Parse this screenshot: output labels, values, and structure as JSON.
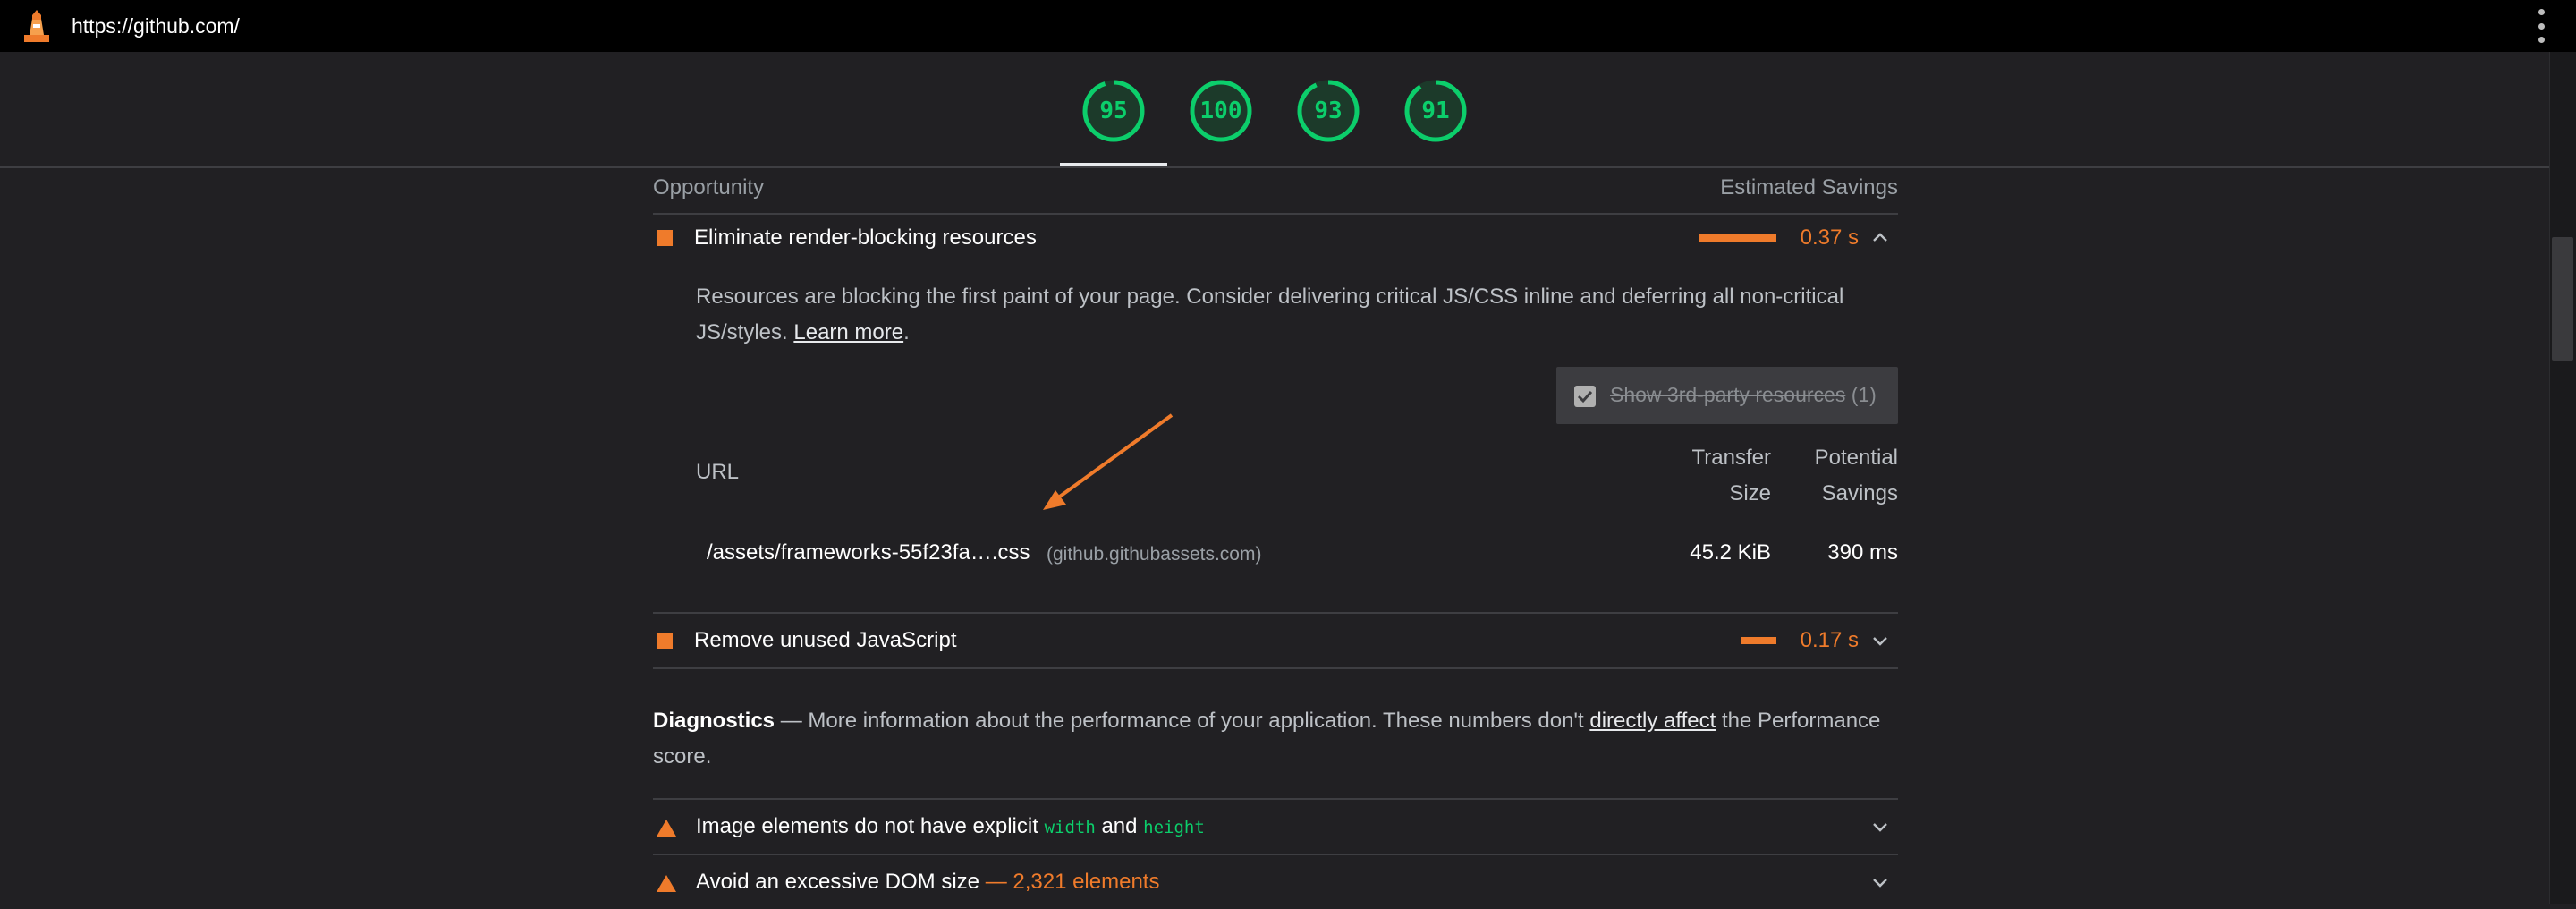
{
  "address_bar": {
    "url": "https://github.com/"
  },
  "scores": [
    {
      "value": "95",
      "fraction": 0.95
    },
    {
      "value": "100",
      "fraction": 1.0
    },
    {
      "value": "93",
      "fraction": 0.93
    },
    {
      "value": "91",
      "fraction": 0.91
    }
  ],
  "colors": {
    "pass": "#0cce6b",
    "warn": "#ef7b2b",
    "background": "#212023"
  },
  "opportunities": {
    "col_left": "Opportunity",
    "col_right": "Estimated Savings",
    "items": [
      {
        "title": "Eliminate render-blocking resources",
        "savings": "0.37 s",
        "expanded": true,
        "description": "Resources are blocking the first paint of your page. Consider delivering critical JS/CSS inline and deferring all non-critical JS/styles.",
        "learn_more": "Learn more",
        "third_party_toggle": {
          "label": "Show 3rd-party resources",
          "count": "(1)",
          "checked": true
        },
        "table": {
          "col_url": "URL",
          "col_transfer_1": "Transfer",
          "col_transfer_2": "Size",
          "col_savings_1": "Potential",
          "col_savings_2": "Savings",
          "rows": [
            {
              "url": "/assets/frameworks-55f23fa….css",
              "host": "(github.githubassets.com)",
              "size": "45.2 KiB",
              "savings": "390 ms"
            }
          ]
        }
      },
      {
        "title": "Remove unused JavaScript",
        "savings": "0.17 s",
        "expanded": false
      }
    ]
  },
  "diagnostics": {
    "heading": "Diagnostics",
    "dash": "—",
    "text_before": "More information about the performance of your application. These numbers don't",
    "link": "directly affect",
    "text_after": "the Performance score.",
    "items": [
      {
        "title_pre": "Image elements do not have explicit",
        "code1": "width",
        "and": "and",
        "code2": "height"
      },
      {
        "title": "Avoid an excessive DOM size",
        "dash": "—",
        "detail": "2,321 elements"
      }
    ]
  }
}
